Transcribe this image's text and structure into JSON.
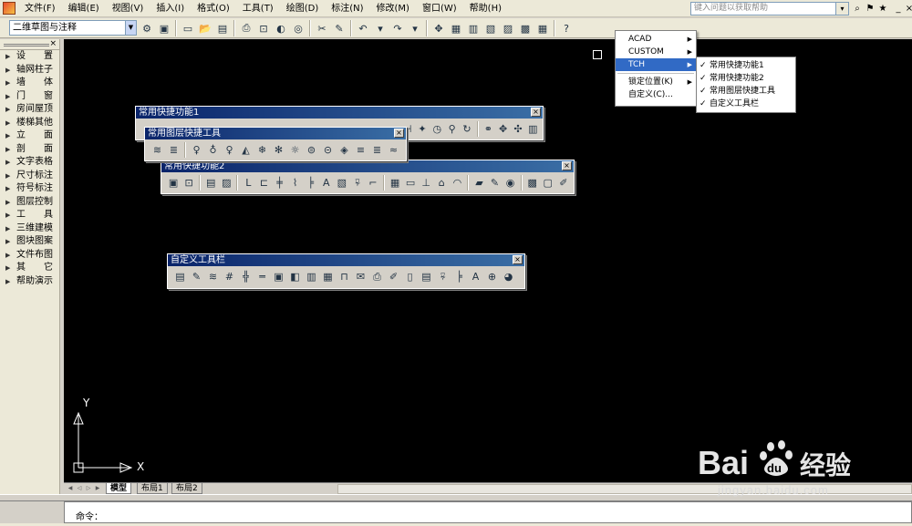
{
  "menubar": {
    "items": [
      "文件(F)",
      "编辑(E)",
      "视图(V)",
      "插入(I)",
      "格式(O)",
      "工具(T)",
      "绘图(D)",
      "标注(N)",
      "修改(M)",
      "窗口(W)",
      "帮助(H)"
    ],
    "help_placeholder": "键入问题以获取帮助"
  },
  "workspace": {
    "value": "二维草图与注释"
  },
  "left_panel": {
    "items": [
      "设　　置",
      "轴网柱子",
      "墙　　体",
      "门　　窗",
      "房间屋顶",
      "楼梯其他",
      "立　　面",
      "剖　　面",
      "文字表格",
      "尺寸标注",
      "符号标注",
      "图层控制",
      "工　　具",
      "三维建模",
      "图块图案",
      "文件布图",
      "其　　它",
      "帮助演示"
    ]
  },
  "toolbars": {
    "tb1": {
      "title": "常用快捷功能1"
    },
    "layer": {
      "title": "常用图层快捷工具"
    },
    "tb2": {
      "title": "常用快捷功能2"
    },
    "custom": {
      "title": "自定义工具栏"
    }
  },
  "ucs": {
    "x_label": "X",
    "y_label": "Y"
  },
  "tabs": {
    "model": "模型",
    "layout1": "布局1",
    "layout2": "布局2"
  },
  "command": {
    "prompt": "命令："
  },
  "context_menu": {
    "items": [
      "ACAD",
      "CUSTOM",
      "TCH"
    ],
    "lock": "锁定位置(K)",
    "customize": "自定义(C)..."
  },
  "submenu": {
    "items": [
      "常用快捷功能1",
      "常用快捷功能2",
      "常用图层快捷工具",
      "自定义工具栏"
    ]
  },
  "watermark": {
    "text": "Bai du 经验",
    "url": "jingyan.baidu.com"
  }
}
